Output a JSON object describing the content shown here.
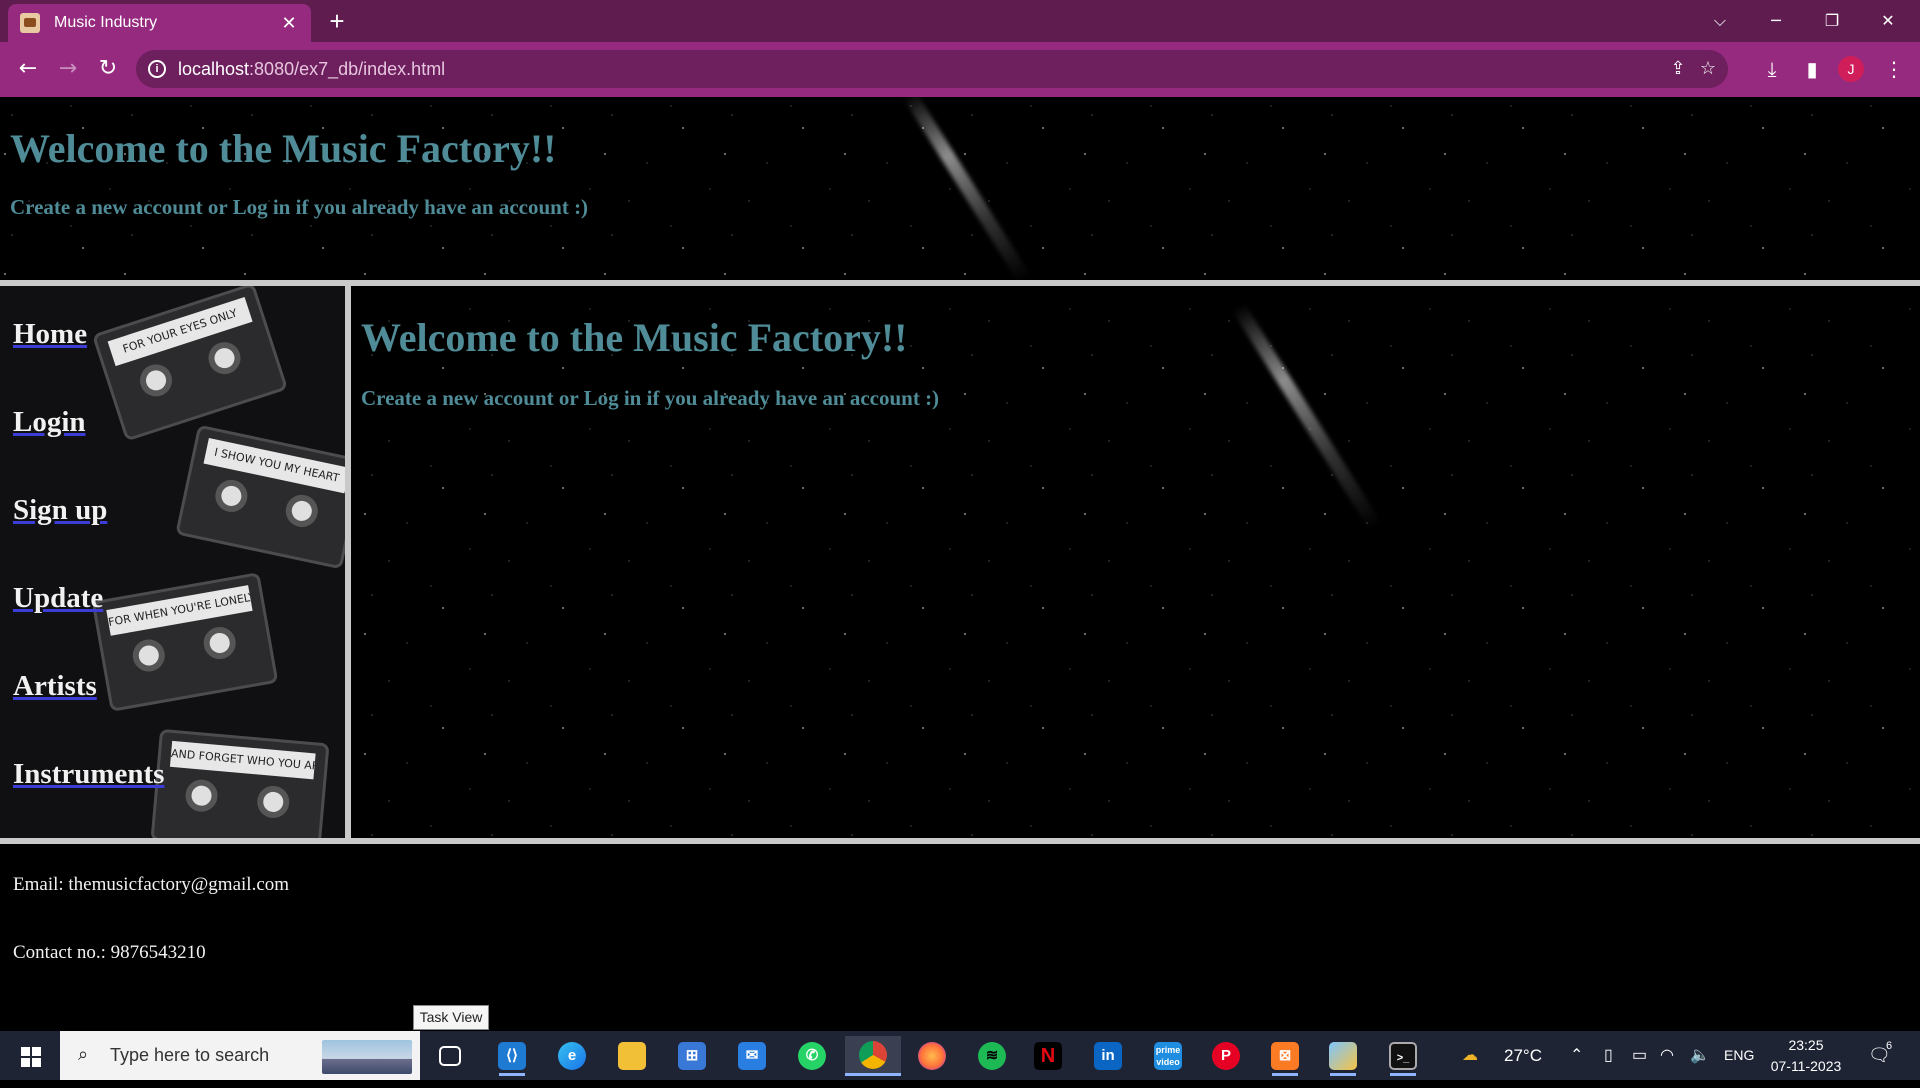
{
  "browser": {
    "tab_title": "Music Industry",
    "tab_close": "✕",
    "new_tab": "+",
    "url_host": "localhost",
    "url_path": ":8080/ex7_db/index.html",
    "profile_initial": "J"
  },
  "header": {
    "title": "Welcome to the Music Factory!!",
    "subtitle": "Create a new account or Log in if you already have an account :)"
  },
  "sidebar": {
    "links": [
      "Home",
      "Login",
      "Sign up",
      "Update",
      "Artists",
      "Instruments"
    ],
    "cassette_labels": [
      "FOR YOUR EYES ONLY",
      "I SHOW YOU MY HEART",
      "FOR WHEN YOU'RE LONELY",
      "AND FORGET WHO YOU ARE"
    ]
  },
  "main": {
    "title": "Welcome to the Music Factory!!",
    "subtitle": "Create a new account or Log in if you already have an account :)"
  },
  "footer": {
    "email": "Email: themusicfactory@gmail.com",
    "contact": "Contact no.: 9876543210"
  },
  "tooltip": "Task View",
  "taskbar": {
    "search_placeholder": "Type here to search",
    "weather": "27°C",
    "language": "ENG",
    "time": "23:25",
    "date": "07-11-2023",
    "notifications": "6"
  },
  "colors": {
    "tab_bar": "#5e1c4f",
    "toolbar": "#962a7f",
    "heading": "#4f8c97",
    "link_underline": "#3c3cd6"
  }
}
